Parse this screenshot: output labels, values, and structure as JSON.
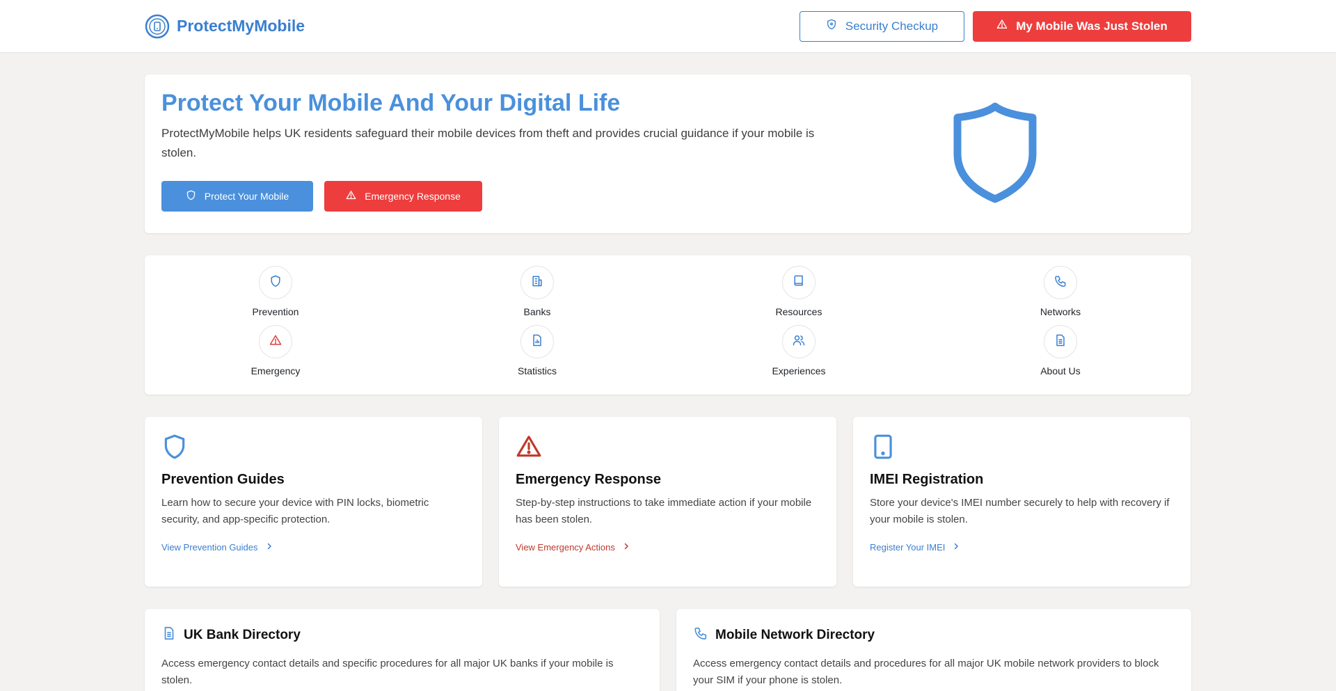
{
  "header": {
    "logo_text": "ProtectMyMobile",
    "security_checkup_label": "Security Checkup",
    "stolen_label": "My Mobile Was Just Stolen"
  },
  "hero": {
    "title": "Protect Your Mobile And Your Digital Life",
    "description": "ProtectMyMobile helps UK residents safeguard their mobile devices from theft and provides crucial guidance if your mobile is stolen.",
    "primary_button": "Protect Your Mobile",
    "emergency_button": "Emergency Response"
  },
  "nav": {
    "items": [
      {
        "label": "Prevention",
        "icon": "shield-icon"
      },
      {
        "label": "Banks",
        "icon": "building-icon"
      },
      {
        "label": "Resources",
        "icon": "book-icon"
      },
      {
        "label": "Networks",
        "icon": "phone-icon"
      },
      {
        "label": "Emergency",
        "icon": "alert-triangle-icon"
      },
      {
        "label": "Statistics",
        "icon": "chart-file-icon"
      },
      {
        "label": "Experiences",
        "icon": "users-icon"
      },
      {
        "label": "About Us",
        "icon": "document-icon"
      }
    ]
  },
  "features": [
    {
      "title": "Prevention Guides",
      "description": "Learn how to secure your device with PIN locks, biometric security, and app-specific protection.",
      "link": "View Prevention Guides",
      "icon": "shield-icon"
    },
    {
      "title": "Emergency Response",
      "description": "Step-by-step instructions to take immediate action if your mobile has been stolen.",
      "link": "View Emergency Actions",
      "icon": "alert-triangle-icon"
    },
    {
      "title": "IMEI Registration",
      "description": "Store your device's IMEI number securely to help with recovery if your mobile is stolen.",
      "link": "Register Your IMEI",
      "icon": "tablet-icon"
    }
  ],
  "directories": [
    {
      "title": "UK Bank Directory",
      "description": "Access emergency contact details and specific procedures for all major UK banks if your mobile is stolen.",
      "icon": "document-icon"
    },
    {
      "title": "Mobile Network Directory",
      "description": "Access emergency contact details and procedures for all major UK mobile network providers to block your SIM if your phone is stolen.",
      "icon": "phone-icon"
    }
  ],
  "colors": {
    "brand_blue": "#4a90dc",
    "danger_red": "#ee3d3d",
    "link_red": "#c0392b",
    "background": "#f3f2f1"
  }
}
